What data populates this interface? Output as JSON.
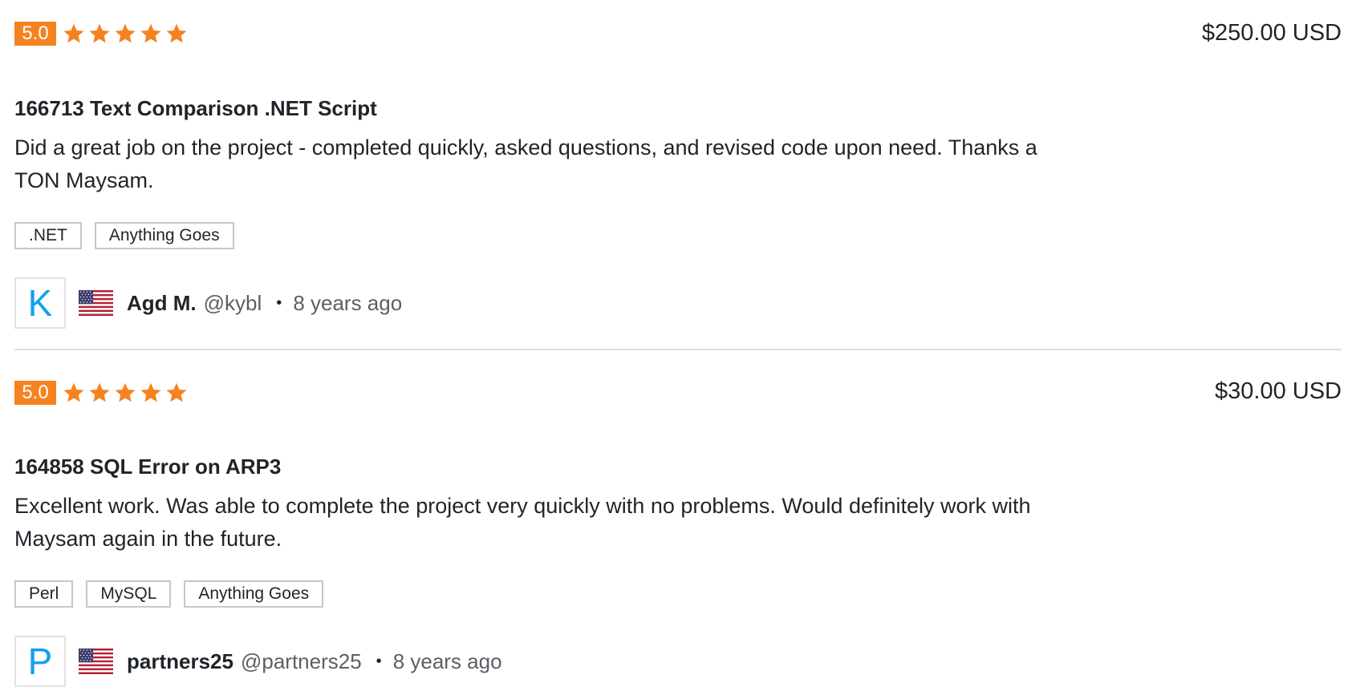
{
  "colors": {
    "rating_badge": "#f5821f",
    "star": "#f5821f",
    "avatar_letter": "#139ff0",
    "text": "#1f2429",
    "muted_text": "#5a5f64",
    "divider": "#dedede"
  },
  "reviews": [
    {
      "rating": "5.0",
      "stars": 5,
      "price": "$250.00 USD",
      "project_title": "166713 Text Comparison .NET Script",
      "text": "Did a great job on the project - completed quickly, asked questions, and revised code upon need. Thanks a TON Maysam.",
      "tags": [
        ".NET",
        "Anything Goes"
      ],
      "user": {
        "avatar_letter": "K",
        "flag_icon": "us-flag-icon",
        "name": "Agd M.",
        "handle": "@kybl",
        "separator": "•",
        "time_ago": "8 years ago"
      }
    },
    {
      "rating": "5.0",
      "stars": 5,
      "price": "$30.00 USD",
      "project_title": "164858 SQL Error on ARP3",
      "text": "Excellent work. Was able to complete the project very quickly with no problems. Would definitely work with Maysam again in the future.",
      "tags": [
        "Perl",
        "MySQL",
        "Anything Goes"
      ],
      "user": {
        "avatar_letter": "P",
        "flag_icon": "us-flag-icon",
        "name": "partners25",
        "handle": "@partners25",
        "separator": "•",
        "time_ago": "8 years ago"
      }
    }
  ]
}
